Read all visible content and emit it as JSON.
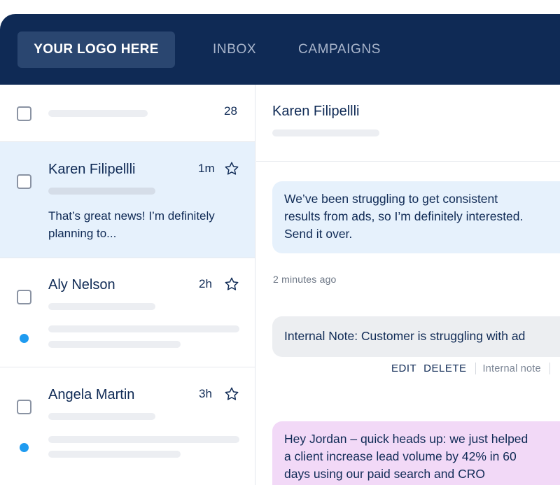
{
  "header": {
    "logo": "YOUR LOGO HERE",
    "nav": [
      "INBOX",
      "CAMPAIGNS"
    ]
  },
  "list": {
    "count": "28",
    "items": [
      {
        "name": "Karen Filipellli",
        "time": "1m",
        "preview_line1": "That’s great news! I’m definitely",
        "preview_line2": "planning to...",
        "selected": true,
        "unread": false
      },
      {
        "name": "Aly Nelson",
        "time": "2h",
        "unread": true
      },
      {
        "name": "Angela Martin",
        "time": "3h",
        "unread": true
      }
    ]
  },
  "conversation": {
    "title": "Karen Filipellli",
    "message": {
      "line1": "We’ve been struggling to get consistent",
      "line2": "results from ads, so I’m definitely interested.",
      "line3": "Send it over."
    },
    "message_meta": "2 minutes ago",
    "note": "Internal Note: Customer is struggling with ad",
    "actions": {
      "edit": "EDIT",
      "delete": "DELETE",
      "label": "Internal note"
    },
    "reply": {
      "line1": "Hey Jordan – quick heads up: we just helped",
      "line2": "a client increase lead volume by 42% in 60",
      "line3": "days using our paid search and CRO"
    }
  },
  "colors": {
    "navy": "#0f2a55",
    "accent": "#1f9bf0",
    "selected_bg": "#e6f1fc",
    "pink_bubble": "#f2d9f7"
  }
}
